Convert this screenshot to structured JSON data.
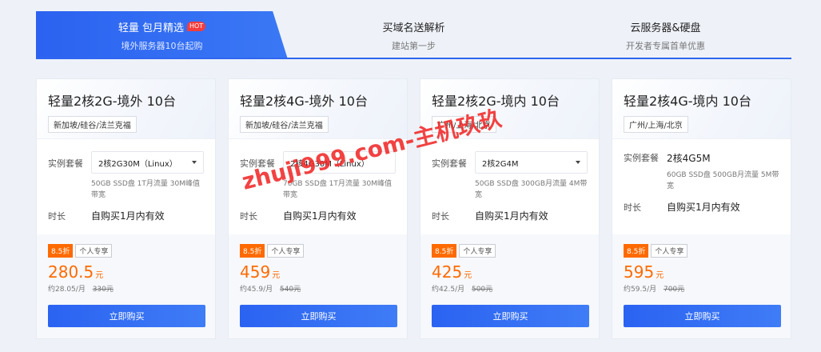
{
  "tabs": [
    {
      "title": "轻量 包月精选",
      "hot": "HOT",
      "subtitle": "境外服务器10台起购"
    },
    {
      "title": "买域名送解析",
      "subtitle": "建站第一步"
    },
    {
      "title": "云服务器&硬盘",
      "subtitle": "开发者专属首单优惠"
    }
  ],
  "labels": {
    "plan": "实例套餐",
    "duration": "时长",
    "buy": "立即购买",
    "currency": "元",
    "per_month_prefix": "约",
    "per_month_suffix": "/月"
  },
  "cards": [
    {
      "title": "轻量2核2G-境外 10台",
      "region": "新加坡/硅谷/法兰克福",
      "plan": "2核2G30M（Linux）",
      "spec": "50GB SSD盘 1T月流量 30M峰值带宽",
      "duration": "自购买1月内有效",
      "discount": "8.5折",
      "personal": "个人专享",
      "price": "280.5",
      "monthly": "28.05",
      "original": "330元"
    },
    {
      "title": "轻量2核4G-境外 10台",
      "region": "新加坡/硅谷/法兰克福",
      "plan": "2核4G30M（Linux）",
      "spec": "70GB SSD盘 1T月流量 30M峰值带宽",
      "duration": "自购买1月内有效",
      "discount": "8.5折",
      "personal": "个人专享",
      "price": "459",
      "monthly": "45.9",
      "original": "540元"
    },
    {
      "title": "轻量2核2G-境内 10台",
      "region": "广州/上海/北京",
      "plan": "2核2G4M",
      "spec": "50GB SSD盘 300GB月流量 4M带宽",
      "duration": "自购买1月内有效",
      "discount": "8.5折",
      "personal": "个人专享",
      "price": "425",
      "monthly": "42.5",
      "original": "500元"
    },
    {
      "title": "轻量2核4G-境内 10台",
      "region": "广州/上海/北京",
      "plan": "2核4G5M",
      "spec": "60GB SSD盘 500GB月流量 5M带宽",
      "duration": "自购买1月内有效",
      "discount": "8.5折",
      "personal": "个人专享",
      "price": "595",
      "monthly": "59.5",
      "original": "700元"
    }
  ],
  "watermark": "zhuji999.com-主机玖玖",
  "colors": {
    "accent": "#2f66f0",
    "price": "#ff6a00",
    "hot": "#f53c3c"
  }
}
